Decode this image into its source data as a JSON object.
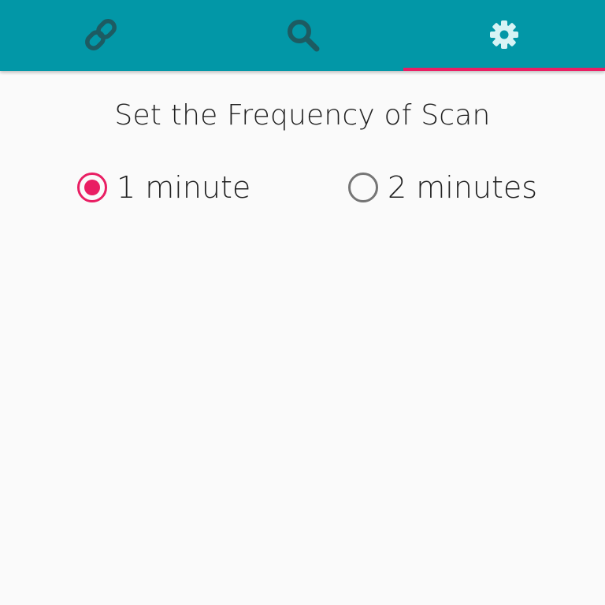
{
  "colors": {
    "tabbar_bg": "#0297a7",
    "accent": "#e91e63",
    "unselected_icon": "#1d5b62",
    "selected_icon": "#d7f3f5",
    "radio_unchecked": "#757575",
    "background": "#fafafa",
    "text": "#212121"
  },
  "tabs": [
    {
      "icon": "link-icon",
      "selected": false
    },
    {
      "icon": "search-icon",
      "selected": false
    },
    {
      "icon": "gear-icon",
      "selected": true
    }
  ],
  "settings": {
    "title": "Set the Frequency of Scan",
    "options": [
      {
        "label": "1 minute",
        "checked": true
      },
      {
        "label": "2 minutes",
        "checked": false
      }
    ]
  }
}
